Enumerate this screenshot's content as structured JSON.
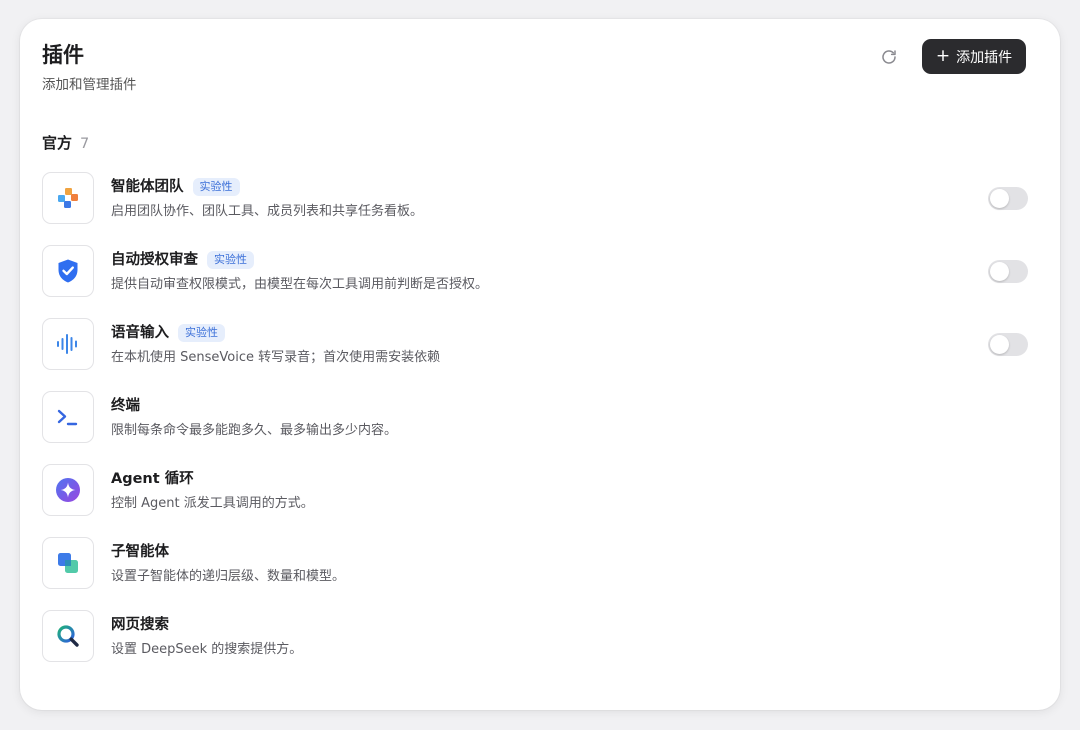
{
  "header": {
    "title": "插件",
    "subtitle": "添加和管理插件",
    "refresh_icon": "refresh-icon",
    "add_button_label": "添加插件",
    "add_button_icon": "plus-icon"
  },
  "section": {
    "title": "官方",
    "count": "7"
  },
  "plugins": [
    {
      "name": "智能体团队",
      "badge": "实验性",
      "description": "启用团队协作、团队工具、成员列表和共享任务看板。",
      "icon": "team-icon",
      "toggle_on": false
    },
    {
      "name": "自动授权审查",
      "badge": "实验性",
      "description": "提供自动审查权限模式，由模型在每次工具调用前判断是否授权。",
      "icon": "shield-check-icon",
      "toggle_on": false
    },
    {
      "name": "语音输入",
      "badge": "实验性",
      "description": "在本机使用 SenseVoice 转写录音；首次使用需安装依赖",
      "icon": "sound-wave-icon",
      "toggle_on": false
    },
    {
      "name": "终端",
      "description": "限制每条命令最多能跑多久、最多输出多少内容。",
      "icon": "terminal-icon"
    },
    {
      "name": "Agent 循环",
      "description": "控制 Agent 派发工具调用的方式。",
      "icon": "agent-star-icon"
    },
    {
      "name": "子智能体",
      "description": "设置子智能体的递归层级、数量和模型。",
      "icon": "layers-icon"
    },
    {
      "name": "网页搜索",
      "description": "设置 DeepSeek 的搜索提供方。",
      "icon": "search-icon"
    }
  ],
  "colors": {
    "accent_blue": "#3b6fd8",
    "badge_bg": "#e6eefc",
    "button_dark": "#2b2b2e",
    "toggle_off": "#e2e2e5"
  }
}
